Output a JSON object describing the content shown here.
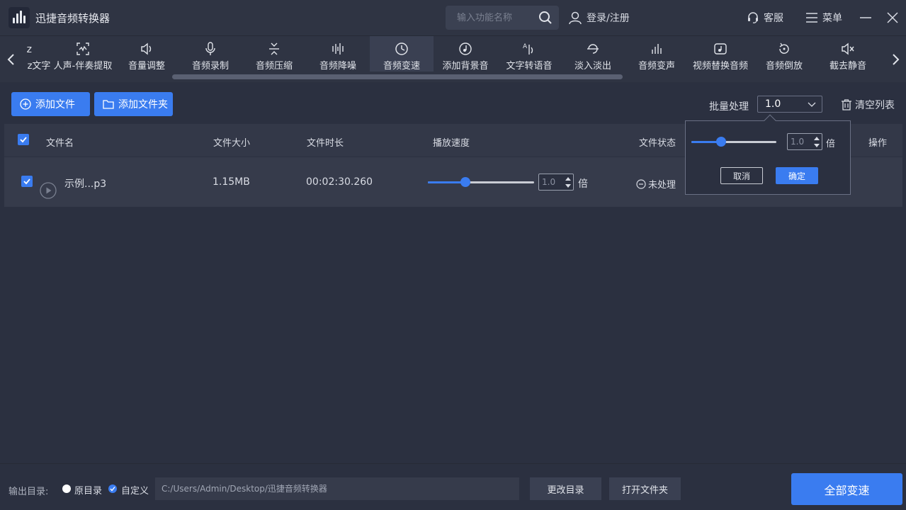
{
  "app": {
    "title": "迅捷音频转换器"
  },
  "header": {
    "search_placeholder": "输入功能名称",
    "login_label": "登录/注册",
    "service_label": "客服",
    "menu_label": "菜单"
  },
  "toolbar": {
    "items": [
      {
        "label": "z文字",
        "icon": "text-icon"
      },
      {
        "label": "人声-伴奏提取",
        "icon": "vocal-extract-icon"
      },
      {
        "label": "音量调整",
        "icon": "volume-icon"
      },
      {
        "label": "音频录制",
        "icon": "microphone-icon"
      },
      {
        "label": "音频压缩",
        "icon": "compress-icon"
      },
      {
        "label": "音频降噪",
        "icon": "denoise-icon"
      },
      {
        "label": "音频变速",
        "icon": "speed-icon",
        "active": true
      },
      {
        "label": "添加背景音",
        "icon": "background-music-icon"
      },
      {
        "label": "文字转语音",
        "icon": "tts-icon"
      },
      {
        "label": "淡入淡出",
        "icon": "fade-icon"
      },
      {
        "label": "音频变声",
        "icon": "voice-change-icon"
      },
      {
        "label": "视频替换音频",
        "icon": "video-replace-icon"
      },
      {
        "label": "音频倒放",
        "icon": "reverse-icon"
      },
      {
        "label": "截去静音",
        "icon": "mute-icon"
      }
    ]
  },
  "actions": {
    "add_file": "添加文件",
    "add_folder": "添加文件夹",
    "batch_label": "批量处理",
    "batch_value": "1.0",
    "clear_list": "清空列表"
  },
  "table": {
    "headers": {
      "filename": "文件名",
      "size": "文件大小",
      "duration": "文件时长",
      "speed": "播放速度",
      "status": "文件状态",
      "action": "操作"
    },
    "rows": [
      {
        "filename": "示例...p3",
        "size": "1.15MB",
        "duration": "00:02:30.260",
        "speed": "1.0",
        "speed_unit": "倍",
        "speed_fraction": 0.35,
        "status": "未处理"
      }
    ]
  },
  "popover": {
    "speed_value": "1.0",
    "unit": "倍",
    "speed_fraction": 0.35,
    "cancel": "取消",
    "confirm": "确定"
  },
  "footer": {
    "output_label": "输出目录:",
    "option_original": "原目录",
    "option_custom": "自定义",
    "path": "C:/Users/Admin/Desktop/迅捷音频转换器",
    "change_dir": "更改目录",
    "open_folder": "打开文件夹",
    "start_all": "全部变速"
  },
  "colors": {
    "accent": "#3a7cf0",
    "background": "#2b3040",
    "header": "#2f3443"
  }
}
